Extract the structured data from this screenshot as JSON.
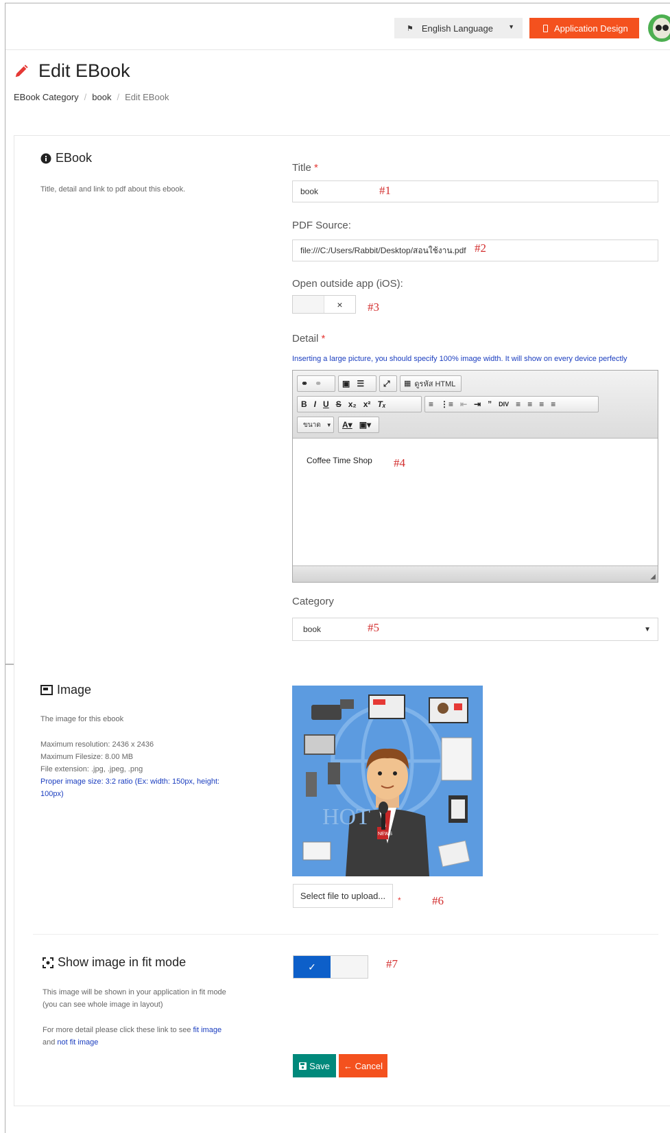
{
  "header": {
    "language_label": "English Language",
    "app_design_label": "Application Design"
  },
  "page": {
    "title": "Edit EBook",
    "breadcrumb": [
      "EBook Category",
      "book",
      "Edit EBook"
    ]
  },
  "ebook_section": {
    "title": "EBook",
    "description": "Title, detail and link to pdf about this ebook."
  },
  "form": {
    "title_label": "Title",
    "title_value": "book",
    "pdf_label": "PDF Source:",
    "pdf_value": "file:///C:/Users/Rabbit/Desktop/สอนใช้งาน.pdf",
    "open_outside_label": "Open outside app (iOS):",
    "open_outside_state": "×",
    "detail_label": "Detail",
    "detail_hint": "Inserting a large picture, you should specify 100% image width. It will show on every device perfectly",
    "detail_content": "Coffee Time Shop",
    "editor_source_label": "ดูรหัส HTML",
    "editor_size_label": "ขนาด",
    "category_label": "Category",
    "category_value": "book",
    "required_mark": "*"
  },
  "markers": [
    "#1",
    "#2",
    "#3",
    "#4",
    "#5",
    "#6",
    "#7"
  ],
  "image_section": {
    "title": "Image",
    "description": "The image for this ebook",
    "max_resolution": "Maximum resolution: 2436 x 2436",
    "max_filesize": "Maximum Filesize: 8.00 MB",
    "extensions": "File extension: .jpg, .jpeg, .png",
    "proper_size": "Proper image size: 3:2 ratio (Ex: width: 150px, height: 100px)",
    "upload_label": "Select file to upload...",
    "image_text_hot": "HOT",
    "image_text_news": "NEWS"
  },
  "fit_section": {
    "title": "Show image in fit mode",
    "desc_line1": "This image will be shown in your application in fit mode",
    "desc_line2": "(you can see whole image in layout)",
    "more_prefix": "For more detail please click these link to see",
    "link_fit": "fit image",
    "and_text": "and",
    "link_not_fit": "not fit image",
    "toggle_state": "✓"
  },
  "actions": {
    "save": "Save",
    "cancel": "← Cancel"
  },
  "colors": {
    "accent_orange": "#f4511e",
    "save_teal": "#00897b",
    "toggle_blue": "#0d5fc9",
    "required_red": "#e53935"
  }
}
